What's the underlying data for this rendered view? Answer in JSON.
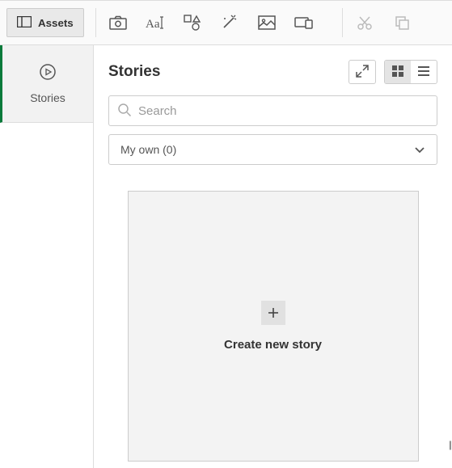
{
  "toolbar": {
    "assets_label": "Assets"
  },
  "sidebar": {
    "items": [
      {
        "label": "Stories"
      }
    ]
  },
  "main": {
    "title": "Stories",
    "search_placeholder": "Search",
    "filter_label": "My own (0)",
    "create_label": "Create new story"
  }
}
